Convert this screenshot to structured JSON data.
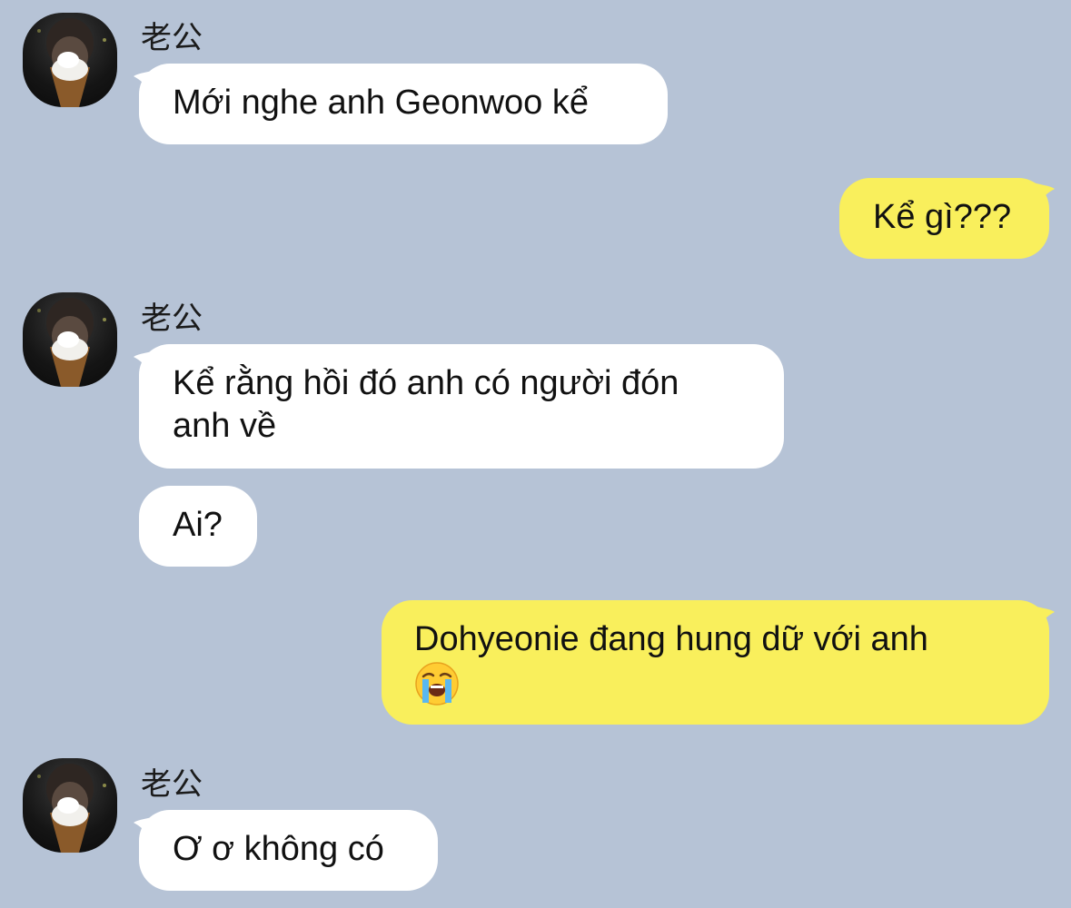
{
  "chat": {
    "messages": [
      {
        "id": "m1",
        "direction": "incoming",
        "sender": "老公",
        "text": "Mới nghe anh Geonwoo kể"
      },
      {
        "id": "m2",
        "direction": "outgoing",
        "text": "Kể gì???"
      },
      {
        "id": "m3",
        "direction": "incoming",
        "sender": "老公",
        "lines": [
          "Kể rằng hồi đó anh có người đón",
          "anh về"
        ]
      },
      {
        "id": "m4",
        "direction": "incoming",
        "text": "Ai?"
      },
      {
        "id": "m5",
        "direction": "outgoing",
        "text": "Dohyeonie đang hung dữ với anh",
        "emoji": "loudly-crying-face"
      },
      {
        "id": "m6",
        "direction": "incoming",
        "sender": "老公",
        "text": "Ơ ơ không có"
      }
    ]
  },
  "colors": {
    "background": "#b6c3d6",
    "incoming_bubble": "#ffffff",
    "outgoing_bubble": "#f9ef5c"
  }
}
